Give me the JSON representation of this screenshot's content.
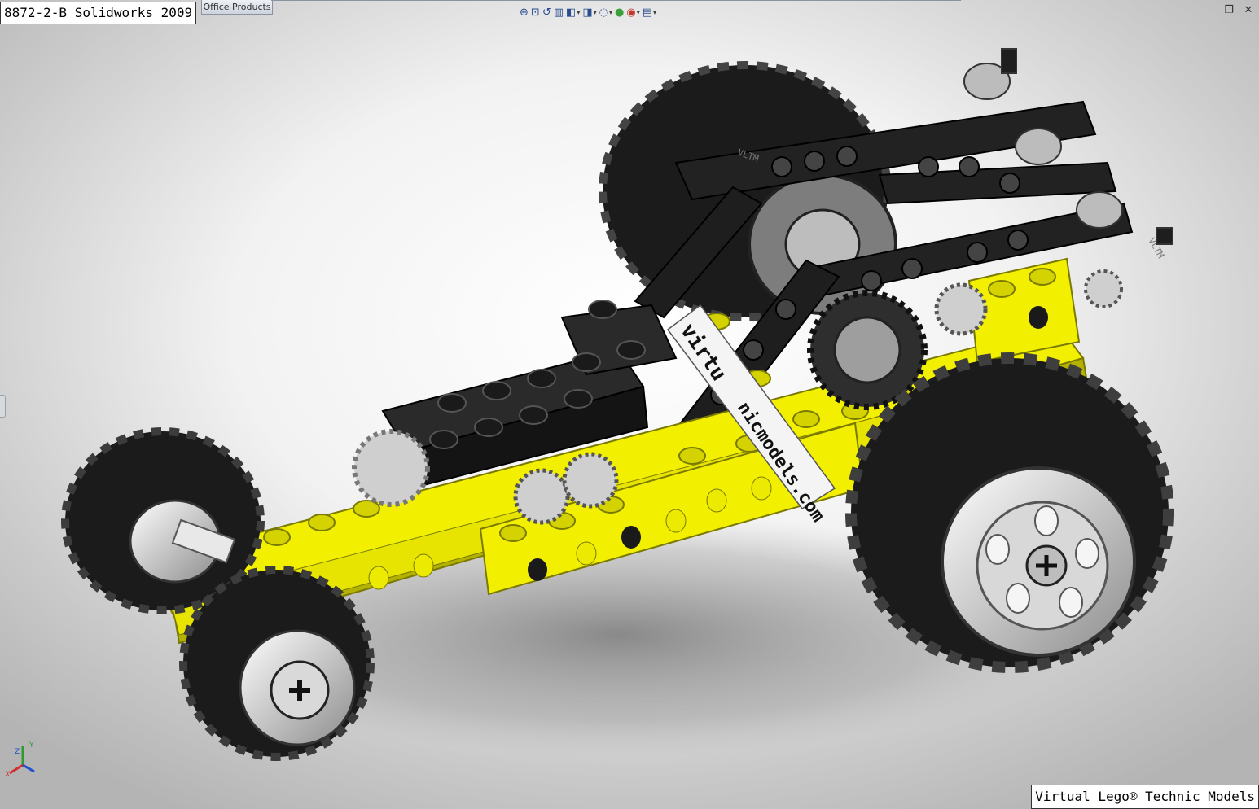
{
  "window": {
    "title": "8872-2-B Solidworks 2009",
    "office_tab": "Office Products"
  },
  "toolbar": {
    "items": [
      {
        "name": "zoom-to-fit-icon",
        "glyph": "⊕"
      },
      {
        "name": "zoom-to-area-icon",
        "glyph": "⊡"
      },
      {
        "name": "previous-view-icon",
        "glyph": "↺"
      },
      {
        "name": "section-view-icon",
        "glyph": "▥"
      },
      {
        "name": "view-orientation-icon",
        "glyph": "◧",
        "dropdown": true
      },
      {
        "name": "display-style-icon",
        "glyph": "◨",
        "dropdown": true
      },
      {
        "name": "hide-show-items-icon",
        "glyph": "◌",
        "dropdown": true
      },
      {
        "name": "edit-appearance-icon",
        "glyph": "●"
      },
      {
        "name": "apply-scene-icon",
        "glyph": "◉",
        "dropdown": true
      },
      {
        "name": "view-settings-icon",
        "glyph": "▤",
        "dropdown": true
      }
    ]
  },
  "window_controls": {
    "minimize": "_",
    "restore": "❐",
    "close": "✕"
  },
  "model": {
    "decal_text": "www.virtualtechnicmodels.com",
    "decal_visible_1": "virtu",
    "decal_visible_2": "nicmodels.com",
    "beam_text_1": "VLTM",
    "beam_text_2": "VLTM",
    "colors": {
      "yellow": "#f2f000",
      "yellow_dark": "#b4b200",
      "black": "#1c1c1c",
      "gray": "#9a9a9a"
    }
  },
  "triad": {
    "x": "X",
    "y": "Y",
    "z": "Z"
  },
  "watermark": "Virtual Lego® Technic Models"
}
